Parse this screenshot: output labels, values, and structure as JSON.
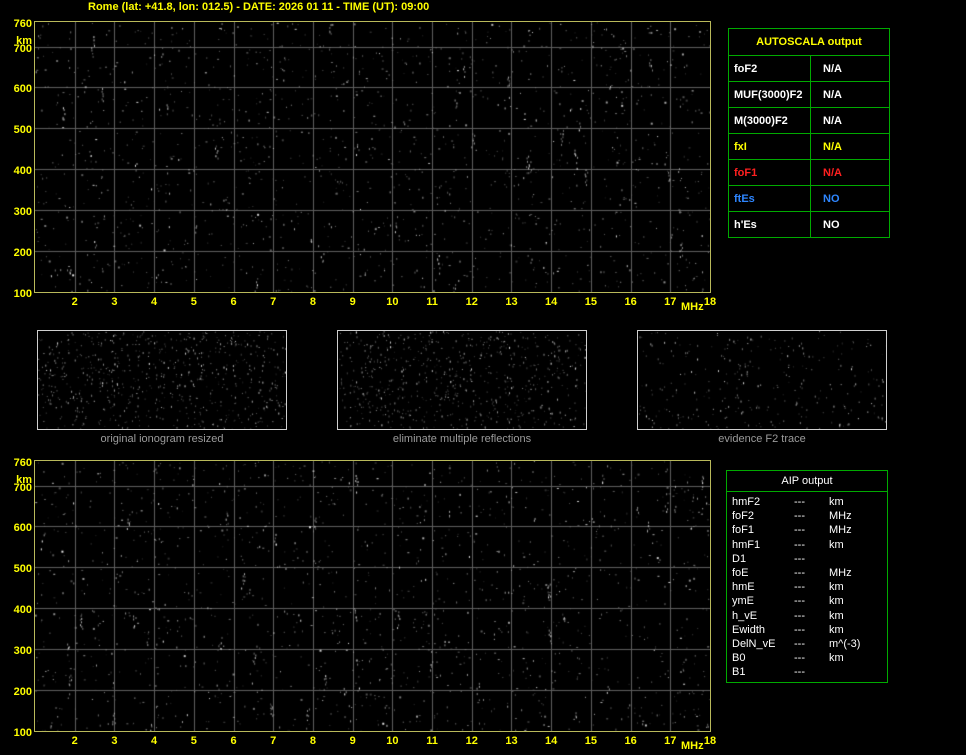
{
  "title": "Rome (lat: +41.8, lon: 012.5) - DATE: 2026 01 11 - TIME (UT): 09:00",
  "ionogram": {
    "y_unit": "km",
    "x_unit": "MHz",
    "y_ticks": [
      "760",
      "700",
      "600",
      "500",
      "400",
      "300",
      "200",
      "100"
    ],
    "x_ticks": [
      "2",
      "3",
      "4",
      "5",
      "6",
      "7",
      "8",
      "9",
      "10",
      "11",
      "12",
      "13",
      "14",
      "15",
      "16",
      "17",
      "18"
    ],
    "y_range": [
      100,
      760
    ],
    "x_range": [
      1,
      18
    ]
  },
  "autoscala_table": {
    "title": "AUTOSCALA output",
    "rows": [
      {
        "label": "foF2",
        "value": "N/A",
        "color": "#ffffff"
      },
      {
        "label": "MUF(3000)F2",
        "value": "N/A",
        "color": "#ffffff"
      },
      {
        "label": "M(3000)F2",
        "value": "N/A",
        "color": "#ffffff"
      },
      {
        "label": "fxI",
        "value": "N/A",
        "color": "#ffff00"
      },
      {
        "label": "foF1",
        "value": "N/A",
        "color": "#ff2020"
      },
      {
        "label": "ftEs",
        "value": "NO",
        "color": "#2e86ff"
      },
      {
        "label": "h'Es",
        "value": "NO",
        "color": "#ffffff"
      }
    ]
  },
  "thumbnails": [
    {
      "caption": "original ionogram resized"
    },
    {
      "caption": "eliminate multiple reflections"
    },
    {
      "caption": "evidence F2 trace"
    }
  ],
  "aip_table": {
    "title": "AIP output",
    "rows": [
      {
        "label": "hmF2",
        "value": "---",
        "unit": "km"
      },
      {
        "label": "foF2",
        "value": "---",
        "unit": "MHz"
      },
      {
        "label": "foF1",
        "value": "---",
        "unit": "MHz"
      },
      {
        "label": "hmF1",
        "value": "---",
        "unit": "km"
      },
      {
        "label": "D1",
        "value": "---",
        "unit": ""
      },
      {
        "label": "foE",
        "value": "---",
        "unit": "MHz"
      },
      {
        "label": "hmE",
        "value": "---",
        "unit": "km"
      },
      {
        "label": "ymE",
        "value": "---",
        "unit": "km"
      },
      {
        "label": "h_vE",
        "value": "---",
        "unit": "km"
      },
      {
        "label": "Ewidth",
        "value": "---",
        "unit": "km"
      },
      {
        "label": "DelN_vE",
        "value": "---",
        "unit": "m^(-3)"
      },
      {
        "label": "B0",
        "value": "---",
        "unit": "km"
      },
      {
        "label": "B1",
        "value": "---",
        "unit": ""
      }
    ]
  },
  "colors": {
    "accent_yellow": "#ffff00",
    "table_border_green": "#00aa00",
    "plot_border": "#b9b95a",
    "grid_gray": "#5f5f5f",
    "caption_gray": "#9b9b9b",
    "foF1_red": "#ff2020",
    "ftEs_blue": "#2e86ff"
  }
}
